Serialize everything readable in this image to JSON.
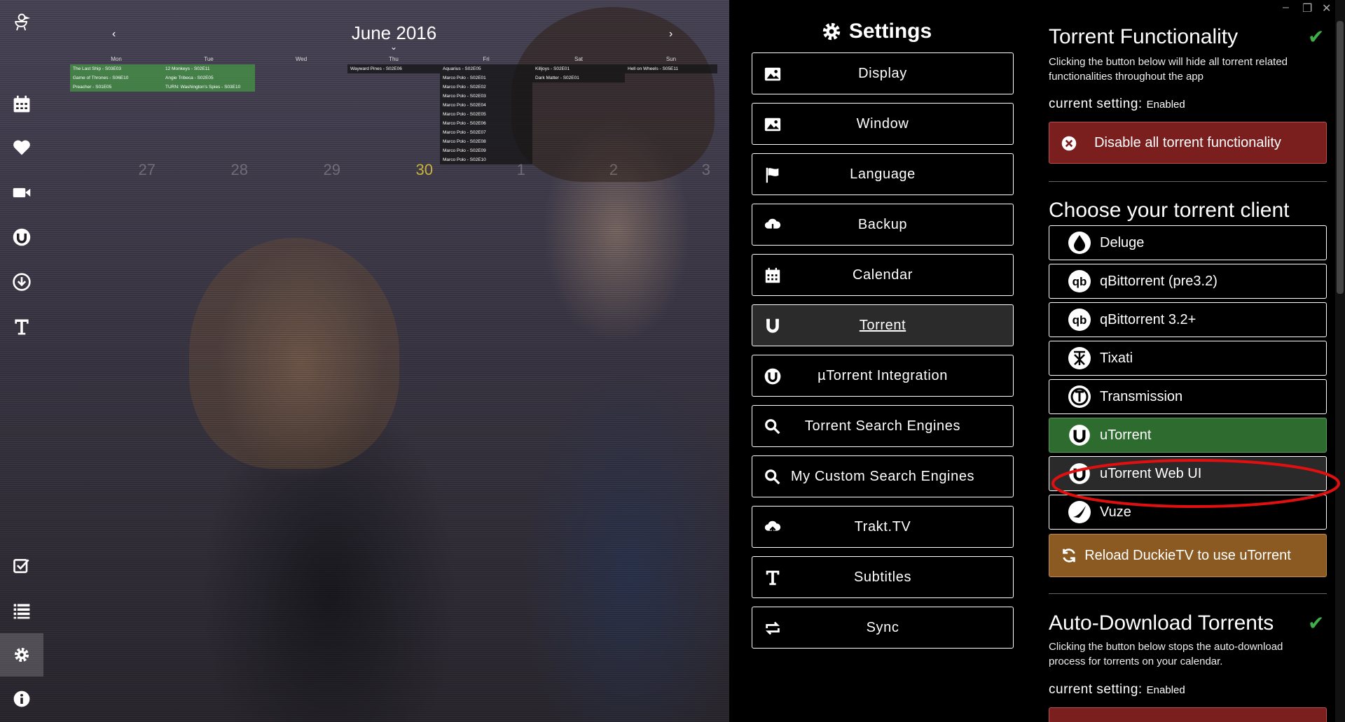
{
  "calendar": {
    "title": "June 2016",
    "prev": "‹",
    "next": "›",
    "caret": "⌄",
    "days": [
      {
        "name": "Mon",
        "num": "27",
        "today": false,
        "events": [
          {
            "label": "The Last Ship - S03E03",
            "style": "green"
          },
          {
            "label": "Game of Thrones - S06E10",
            "style": "green"
          },
          {
            "label": "Preacher - S01E05",
            "style": "green"
          }
        ]
      },
      {
        "name": "Tue",
        "num": "28",
        "today": false,
        "events": [
          {
            "label": "12 Monkeys - S02E11",
            "style": "green"
          },
          {
            "label": "Angie Tribeca - S02E05",
            "style": "green"
          },
          {
            "label": "TURN: Washington's Spies - S03E10",
            "style": "green"
          }
        ]
      },
      {
        "name": "Wed",
        "num": "29",
        "today": false,
        "events": []
      },
      {
        "name": "Thu",
        "num": "30",
        "today": true,
        "events": [
          {
            "label": "Wayward Pines - S02E06",
            "style": "dark"
          }
        ]
      },
      {
        "name": "Fri",
        "num": "1",
        "today": false,
        "events": [
          {
            "label": "Aquarius - S02E05",
            "style": "dark"
          },
          {
            "label": "Marco Polo - S02E01",
            "style": "dark"
          },
          {
            "label": "Marco Polo - S02E02",
            "style": "dark"
          },
          {
            "label": "Marco Polo - S02E03",
            "style": "dark"
          },
          {
            "label": "Marco Polo - S02E04",
            "style": "dark"
          },
          {
            "label": "Marco Polo - S02E05",
            "style": "dark"
          },
          {
            "label": "Marco Polo - S02E06",
            "style": "dark"
          },
          {
            "label": "Marco Polo - S02E07",
            "style": "dark"
          },
          {
            "label": "Marco Polo - S02E08",
            "style": "dark"
          },
          {
            "label": "Marco Polo - S02E09",
            "style": "dark"
          },
          {
            "label": "Marco Polo - S02E10",
            "style": "dark"
          }
        ]
      },
      {
        "name": "Sat",
        "num": "2",
        "today": false,
        "events": [
          {
            "label": "Killjoys - S02E01",
            "style": "dark"
          },
          {
            "label": "Dark Matter - S02E01",
            "style": "dark"
          }
        ]
      },
      {
        "name": "Sun",
        "num": "3",
        "today": false,
        "events": [
          {
            "label": "Hell on Wheels - S05E11",
            "style": "dark"
          }
        ]
      }
    ]
  },
  "sidenav": {
    "items": [
      {
        "name": "logo-duck-icon",
        "active": false
      },
      {
        "name": "calendar-icon",
        "active": false
      },
      {
        "name": "heart-icon",
        "active": false
      },
      {
        "name": "video-camera-icon",
        "active": false
      },
      {
        "name": "utorrent-icon",
        "active": false
      },
      {
        "name": "download-icon",
        "active": false
      },
      {
        "name": "subtitles-icon",
        "active": false
      },
      {
        "name": "checklist-icon",
        "active": false
      },
      {
        "name": "list-icon",
        "active": false
      },
      {
        "name": "gear-icon",
        "active": true
      },
      {
        "name": "info-icon",
        "active": false
      }
    ]
  },
  "settings": {
    "title": "Settings",
    "menu": [
      {
        "label": "Display",
        "icon": "image-icon",
        "active": false
      },
      {
        "label": "Window",
        "icon": "image-icon",
        "active": false
      },
      {
        "label": "Language",
        "icon": "flag-icon",
        "active": false
      },
      {
        "label": "Backup",
        "icon": "cloud-download-icon",
        "active": false
      },
      {
        "label": "Calendar",
        "icon": "calendar-icon",
        "active": false
      },
      {
        "label": "Torrent",
        "icon": "magnet-icon",
        "active": true
      },
      {
        "label": "µTorrent Integration",
        "icon": "utorrent-icon",
        "active": false
      },
      {
        "label": "Torrent Search Engines",
        "icon": "search-icon",
        "active": false
      },
      {
        "label": "My Custom Search Engines",
        "icon": "search-icon",
        "active": false
      },
      {
        "label": "Trakt.TV",
        "icon": "cloud-upload-icon",
        "active": false
      },
      {
        "label": "Subtitles",
        "icon": "subtitles-icon",
        "active": false
      },
      {
        "label": "Sync",
        "icon": "sync-icon",
        "active": false
      }
    ]
  },
  "panel": {
    "torrent_func": {
      "heading": "Torrent Functionality",
      "desc": "Clicking the button below will hide all torrent related functionalities throughout the app",
      "current_label": "current setting:",
      "current_value": "Enabled",
      "button": "Disable all torrent functionality"
    },
    "client": {
      "heading": "Choose your torrent client",
      "clients": [
        {
          "label": "Deluge",
          "icon": "deluge-icon"
        },
        {
          "label": "qBittorrent (pre3.2)",
          "icon": "qbittorrent-icon"
        },
        {
          "label": "qBittorrent 3.2+",
          "icon": "qbittorrent-icon"
        },
        {
          "label": "Tixati",
          "icon": "tixati-icon"
        },
        {
          "label": "Transmission",
          "icon": "transmission-icon"
        },
        {
          "label": "uTorrent",
          "icon": "utorrent-icon"
        },
        {
          "label": "uTorrent Web UI",
          "icon": "utorrent-icon"
        },
        {
          "label": "Vuze",
          "icon": "vuze-icon"
        }
      ],
      "selected": "uTorrent",
      "reload_button": "Reload DuckieTV to use uTorrent"
    },
    "auto_download": {
      "heading": "Auto-Download Torrents",
      "desc": "Clicking the button below stops the auto-download process for torrents on your calendar.",
      "current_label": "current setting:",
      "current_value": "Enabled"
    }
  },
  "colors": {
    "check": "#3fae49",
    "selected_client": "#2e6b2e",
    "disable_button": "#7a1e1e",
    "reload_button": "#8a5a22",
    "highlight_ring": "#e01010"
  }
}
